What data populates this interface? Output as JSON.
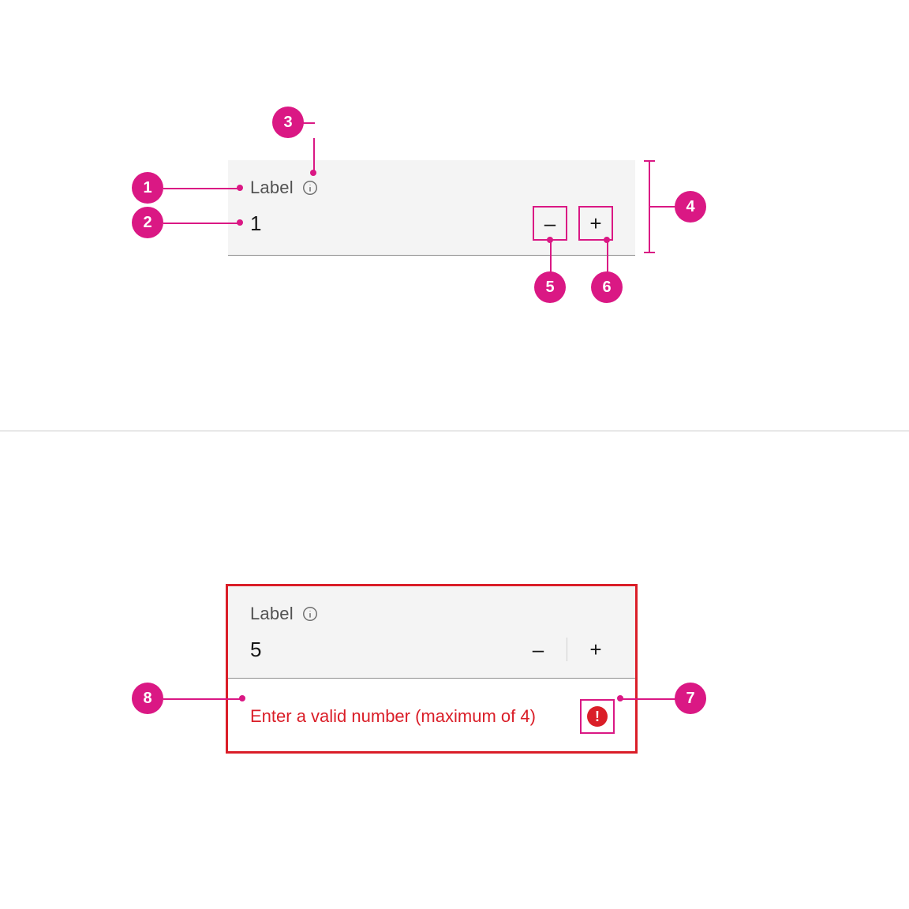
{
  "colors": {
    "accent": "#da1884",
    "error": "#da1e28",
    "field_bg": "#f4f4f4"
  },
  "annotations": {
    "p1": "1",
    "p2": "2",
    "p3": "3",
    "p4": "4",
    "p5": "5",
    "p6": "6",
    "p7": "7",
    "p8": "8"
  },
  "default_spinner": {
    "label": "Label",
    "value": "1",
    "decrement_glyph": "–",
    "increment_glyph": "+"
  },
  "error_spinner": {
    "label": "Label",
    "value": "5",
    "decrement_glyph": "–",
    "increment_glyph": "+",
    "error_message": "Enter a valid number (maximum of 4)"
  }
}
